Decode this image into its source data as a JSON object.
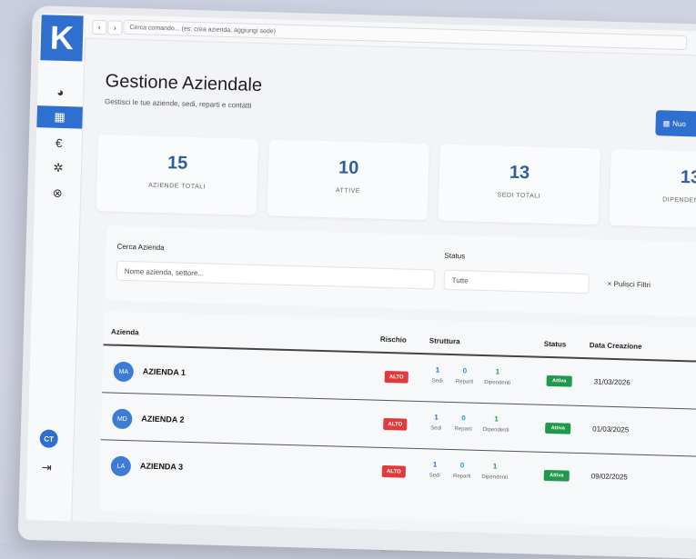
{
  "app": {
    "logo_letter": "K"
  },
  "topbar": {
    "back_icon": "‹",
    "forward_icon": "›",
    "command_placeholder": "Cerca comando... (es: crea azienda, aggiungi sede)"
  },
  "sidebar": {
    "items": [
      {
        "name": "dashboard",
        "icon": "◕"
      },
      {
        "name": "aziende",
        "icon": "▦"
      },
      {
        "name": "finanza",
        "icon": "€"
      },
      {
        "name": "impostazioni",
        "icon": "✲"
      },
      {
        "name": "supporto",
        "icon": "⊗"
      }
    ],
    "user_initials": "CT",
    "logout_icon": "⇥"
  },
  "header": {
    "title": "Gestione Aziendale",
    "subtitle": "Gestisci le tue aziende, sedi, reparti e contatti",
    "new_button": "Nuo",
    "new_button_icon": "▦"
  },
  "stats": [
    {
      "value": "15",
      "label": "AZIENDE TOTALI"
    },
    {
      "value": "10",
      "label": "ATTIVE"
    },
    {
      "value": "13",
      "label": "SEDI TOTALI"
    },
    {
      "value": "13",
      "label": "DIPENDENTI TO"
    }
  ],
  "filters": {
    "search_label": "Cerca Azienda",
    "search_placeholder": "Nome azienda, settore...",
    "status_label": "Status",
    "status_value": "Tutte",
    "clear_label": "× Pulisci Filtri"
  },
  "table": {
    "headers": {
      "azienda": "Azienda",
      "rischio": "Rischio",
      "struttura": "Struttura",
      "status": "Status",
      "data": "Data Creazione"
    },
    "struct_labels": {
      "sedi": "Sedi",
      "reparti": "Reparti",
      "dipendenti": "Dipendenti"
    },
    "rows": [
      {
        "initials": "MA",
        "name": "AZIENDA 1",
        "risk": "ALTO",
        "sedi": "1",
        "reparti": "0",
        "dipendenti": "1",
        "status": "Attiva",
        "date": "31/03/2026"
      },
      {
        "initials": "MD",
        "name": "AZIENDA 2",
        "risk": "ALTO",
        "sedi": "1",
        "reparti": "0",
        "dipendenti": "1",
        "status": "Attiva",
        "date": "01/03/2025"
      },
      {
        "initials": "LA",
        "name": "AZIENDA 3",
        "risk": "ALTO",
        "sedi": "1",
        "reparti": "0",
        "dipendenti": "1",
        "status": "Attiva",
        "date": "09/02/2025"
      }
    ]
  },
  "colors": {
    "accent": "#2f6fd0",
    "risk_high": "#e03a3a",
    "status_active": "#1f9a4a",
    "stat_number": "#2d5f9e"
  }
}
